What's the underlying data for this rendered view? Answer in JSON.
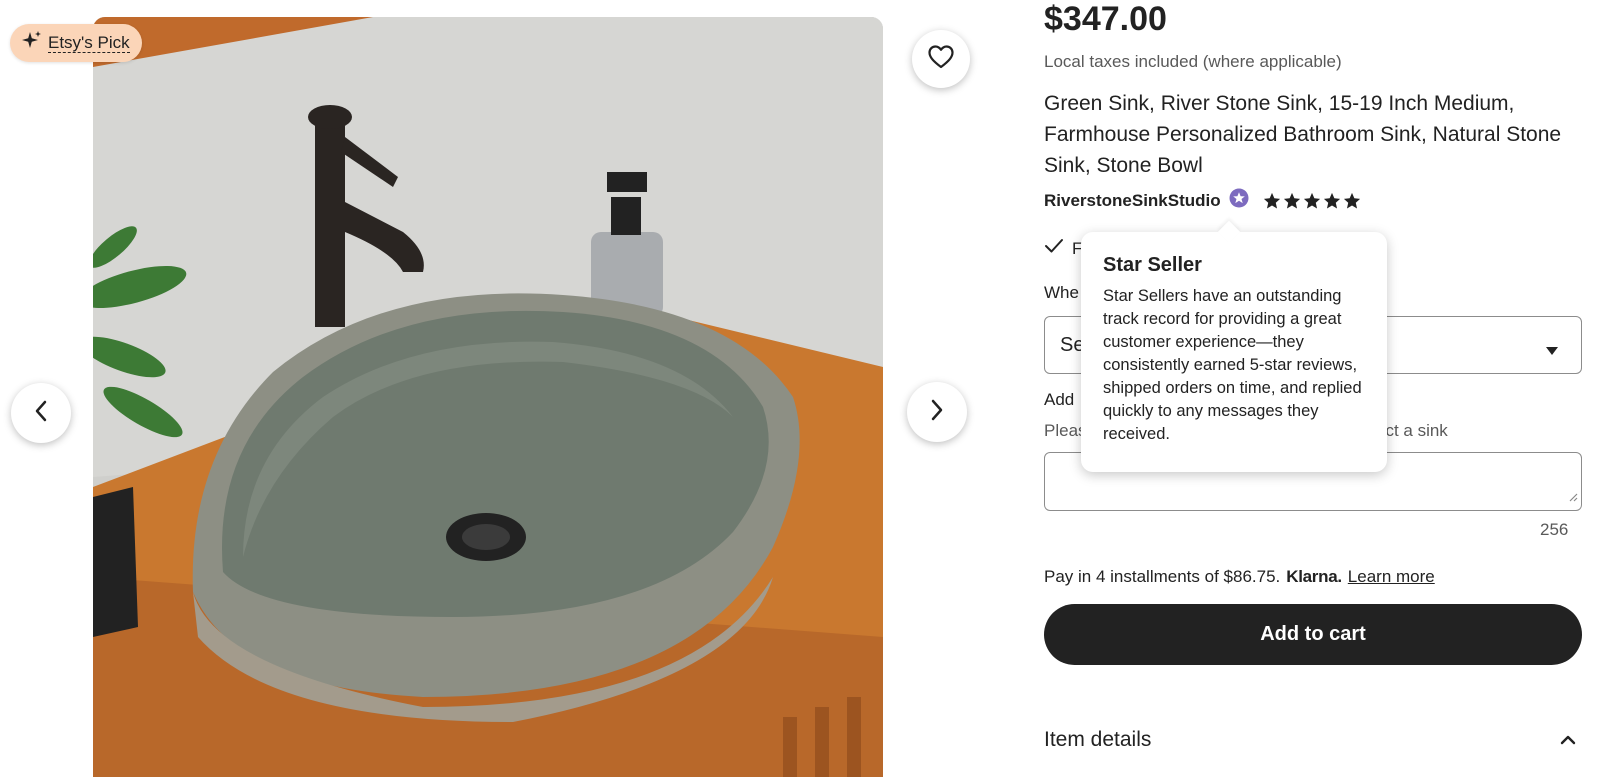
{
  "gallery": {
    "badge_label": "Etsy's Pick",
    "icons": {
      "badge": "sparkle-icon",
      "favorite": "heart-icon",
      "prev": "chevron-left-icon",
      "next": "chevron-right-icon"
    }
  },
  "listing": {
    "price": "$347.00",
    "tax_note": "Local taxes included (where applicable)",
    "title": "Green Sink, River Stone Sink, 15-19 Inch Medium, Farmhouse Personalized Bathroom Sink, Natural Stone Sink, Stone Bowl",
    "shop_name": "RiverstoneSinkStudio",
    "star_seller_icon": "star-seller-badge-icon",
    "rating": 5,
    "rating_max": 5
  },
  "options": {
    "check_text_partial": "F",
    "when_label_partial": "Whe",
    "select_value_partial": "Se",
    "add_label_partial": "Add",
    "help_text_start": "Pleas",
    "help_text_end": "ect a sink",
    "personalization_counter": "256"
  },
  "payment": {
    "installments_text": "Pay in 4 installments of $86.75.",
    "provider": "Klarna.",
    "learn_more": "Learn more",
    "add_to_cart": "Add to cart"
  },
  "details": {
    "label": "Item details"
  },
  "tooltip": {
    "title": "Star Seller",
    "body": "Star Sellers have an outstanding track record for providing a great customer experience—they consistently earned 5-star reviews, shipped orders on time, and replied quickly to any messages they received."
  },
  "colors": {
    "cta_background": "#222222",
    "badge_background": "#fbd5b8",
    "star_seller_purple": "#7d6bbf"
  }
}
